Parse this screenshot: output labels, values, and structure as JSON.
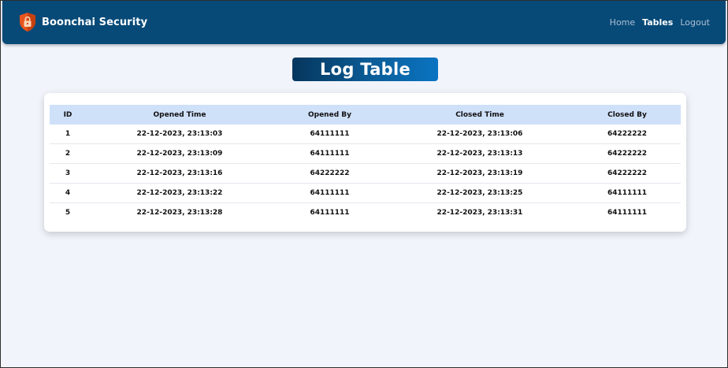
{
  "app": {
    "brand_name": "Boonchai Security"
  },
  "nav": {
    "items": [
      {
        "label": "Home",
        "active": false
      },
      {
        "label": "Tables",
        "active": true
      },
      {
        "label": "Logout",
        "active": false
      }
    ]
  },
  "page": {
    "title": "Log Table"
  },
  "table": {
    "headers": [
      "ID",
      "Opened Time",
      "Opened By",
      "Closed Time",
      "Closed By"
    ],
    "rows": [
      {
        "id": "1",
        "opened_time": "22-12-2023, 23:13:03",
        "opened_by": "64111111",
        "closed_time": "22-12-2023, 23:13:06",
        "closed_by": "64222222"
      },
      {
        "id": "2",
        "opened_time": "22-12-2023, 23:13:09",
        "opened_by": "64111111",
        "closed_time": "22-12-2023, 23:13:13",
        "closed_by": "64222222"
      },
      {
        "id": "3",
        "opened_time": "22-12-2023, 23:13:16",
        "opened_by": "64222222",
        "closed_time": "22-12-2023, 23:13:19",
        "closed_by": "64222222"
      },
      {
        "id": "4",
        "opened_time": "22-12-2023, 23:13:22",
        "opened_by": "64111111",
        "closed_time": "22-12-2023, 23:13:25",
        "closed_by": "64111111"
      },
      {
        "id": "5",
        "opened_time": "22-12-2023, 23:13:28",
        "opened_by": "64111111",
        "closed_time": "22-12-2023, 23:13:31",
        "closed_by": "64111111"
      }
    ]
  },
  "colors": {
    "navbar": "#074a78",
    "page_background": "#f1f4fb",
    "table_header": "#cfe0f9",
    "brand_icon": "#e8541e"
  },
  "icons": {
    "brand": "shield-lock-icon"
  }
}
